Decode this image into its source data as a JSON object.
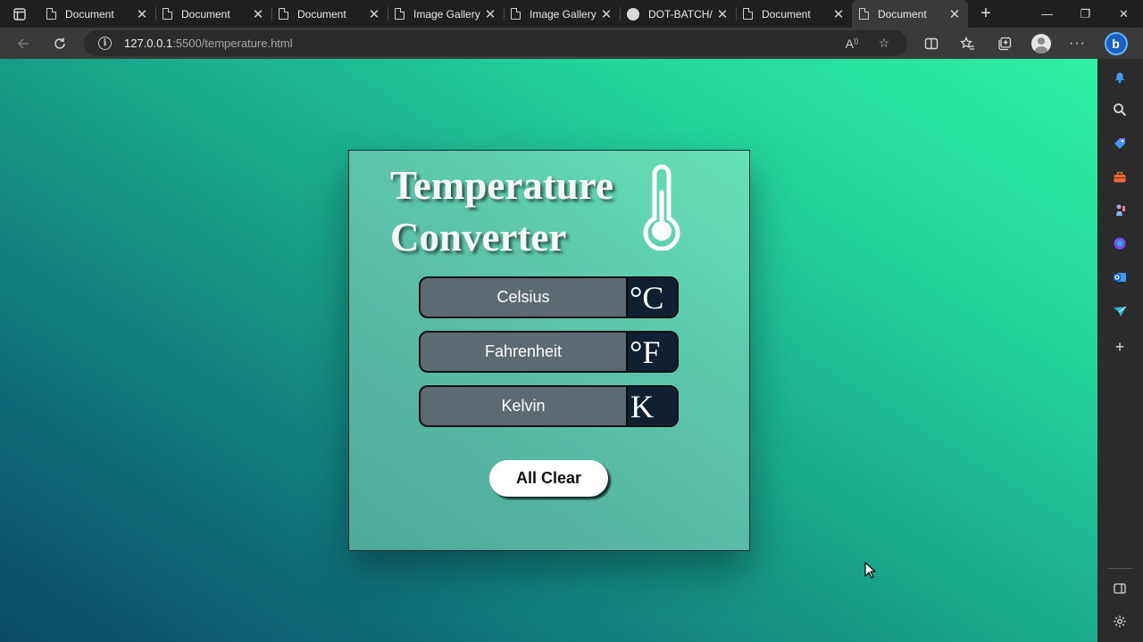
{
  "browser": {
    "tabs": [
      {
        "title": "Document",
        "icon": "document-icon",
        "active": false
      },
      {
        "title": "Document",
        "icon": "document-icon",
        "active": false
      },
      {
        "title": "Document",
        "icon": "document-icon",
        "active": false
      },
      {
        "title": "Image Gallery",
        "icon": "document-icon",
        "active": false
      },
      {
        "title": "Image Gallery",
        "icon": "document-icon",
        "active": false
      },
      {
        "title": "DOT-BATCH/",
        "icon": "github-icon",
        "active": false
      },
      {
        "title": "Document",
        "icon": "document-icon",
        "active": false
      },
      {
        "title": "Document",
        "icon": "document-icon",
        "active": true
      }
    ],
    "url_host": "127.0.0.1",
    "url_path": ":5500/temperature.html",
    "read_aloud_label": "A"
  },
  "page": {
    "heading_line1": "Temperature",
    "heading_line2": "Converter",
    "fields": [
      {
        "placeholder": "Celsius",
        "unit": "°C"
      },
      {
        "placeholder": "Fahrenheit",
        "unit": "°F"
      },
      {
        "placeholder": "Kelvin",
        "unit": "K"
      }
    ],
    "clear_button": "All Clear"
  },
  "sidebar": {
    "icons": [
      "bell-icon",
      "search-icon",
      "tag-icon",
      "toolbox-icon",
      "chess-icon",
      "copilot-icon",
      "outlook-icon",
      "send-icon",
      "add-icon",
      "split-screen-icon",
      "settings-icon"
    ]
  },
  "colors": {
    "bg_dark": "#0b4a63",
    "bg_light": "#2ef0a6",
    "card": "#5cc2a8",
    "field": "#5d6a72",
    "unit_box": "#102033"
  }
}
